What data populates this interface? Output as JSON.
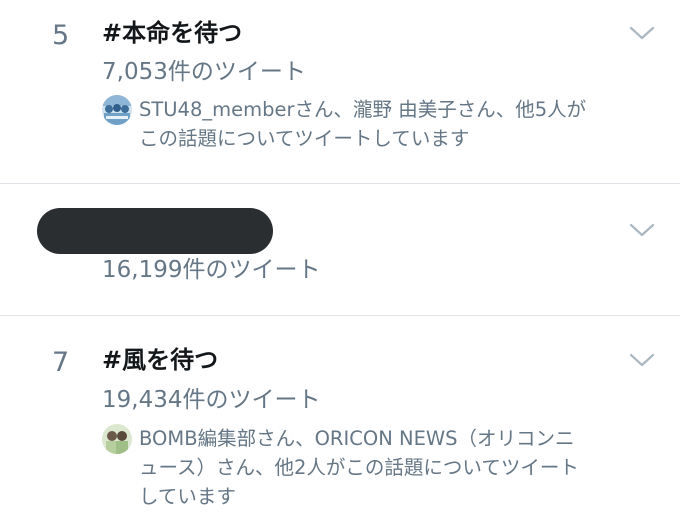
{
  "trends": [
    {
      "rank": "5",
      "hashtag": "#本命を待つ",
      "tweet_count": "7,053件のツイート",
      "context_lines": [
        "STU48_memberさん、瀧野 由美子さん、他5人が",
        "この話題についてツイートしています"
      ],
      "avatar_icon": "group-photo-avatar-icon",
      "menu_icon": "chevron-down-icon"
    },
    {
      "rank": "",
      "hashtag": "",
      "hashtag_redacted": true,
      "tweet_count": "16,199件のツイート",
      "menu_icon": "chevron-down-icon"
    },
    {
      "rank": "7",
      "hashtag": "#風を待つ",
      "tweet_count": "19,434件のツイート",
      "context_lines": [
        "BOMB編集部さん、ORICON NEWS（オリコンニ",
        "ュース）さん、他2人がこの話題についてツイート",
        "しています"
      ],
      "avatar_icon": "magazine-photo-avatar-icon",
      "menu_icon": "chevron-down-icon"
    }
  ],
  "colors": {
    "primary_text": "#14171a",
    "secondary_text": "#657786",
    "divider": "#dfe3e7",
    "chevron": "#aab8c2",
    "redaction": "#2b2e31"
  }
}
